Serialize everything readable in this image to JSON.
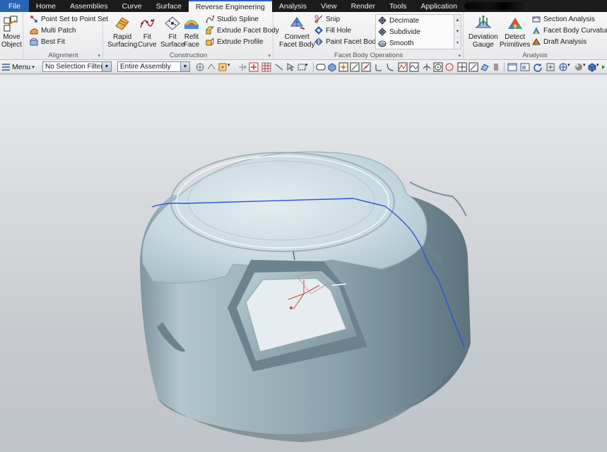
{
  "tabs": [
    {
      "label": "File"
    },
    {
      "label": "Home"
    },
    {
      "label": "Assemblies"
    },
    {
      "label": "Curve"
    },
    {
      "label": "Surface"
    },
    {
      "label": "Reverse Engineering"
    },
    {
      "label": "Analysis"
    },
    {
      "label": "View"
    },
    {
      "label": "Render"
    },
    {
      "label": "Tools"
    },
    {
      "label": "Application"
    }
  ],
  "active_tab": "Reverse Engineering",
  "ribbon": {
    "move_object": {
      "line1": "Move",
      "line2": "Object"
    },
    "alignment": {
      "label": "Alignment",
      "items": [
        "Point Set to Point Set",
        "Multi Patch",
        "Best Fit"
      ]
    },
    "construction": {
      "label": "Construction",
      "rapid_surfacing": {
        "line1": "Rapid",
        "line2": "Surfacing"
      },
      "fit_curve": {
        "line1": "Fit",
        "line2": "Curve"
      },
      "fit_surface": {
        "line1": "Fit",
        "line2": "Surface"
      },
      "refit_face": {
        "line1": "Refit",
        "line2": "Face"
      },
      "items": [
        "Studio Spline",
        "Extrude Facet Body",
        "Extrude Profile"
      ]
    },
    "facet_body_operations": {
      "label": "Facet Body Operations",
      "convert": {
        "line1": "Convert",
        "line2": "Facet Body"
      },
      "items": [
        "Snip",
        "Fill Hole",
        "Paint Facet Body"
      ],
      "gallery": [
        "Decimate",
        "Subdivide",
        "Smooth"
      ]
    },
    "analysis": {
      "label": "Analysis",
      "deviation_gauge": {
        "line1": "Deviation",
        "line2": "Gauge"
      },
      "detect_primitives": {
        "line1": "Detect",
        "line2": "Primitives"
      },
      "items": [
        "Section Analysis",
        "Facet Body Curvature",
        "Draft Analysis"
      ]
    }
  },
  "toolbar": {
    "menu_label": "Menu",
    "selection_filter": "No Selection Filter",
    "assembly_scope": "Entire Assembly"
  },
  "colors": {
    "file_tab": "#2a64b4",
    "tab_bar": "#1b1b1b",
    "section_curve": "#2a52d8",
    "part_surface": "#a9c0ca"
  }
}
